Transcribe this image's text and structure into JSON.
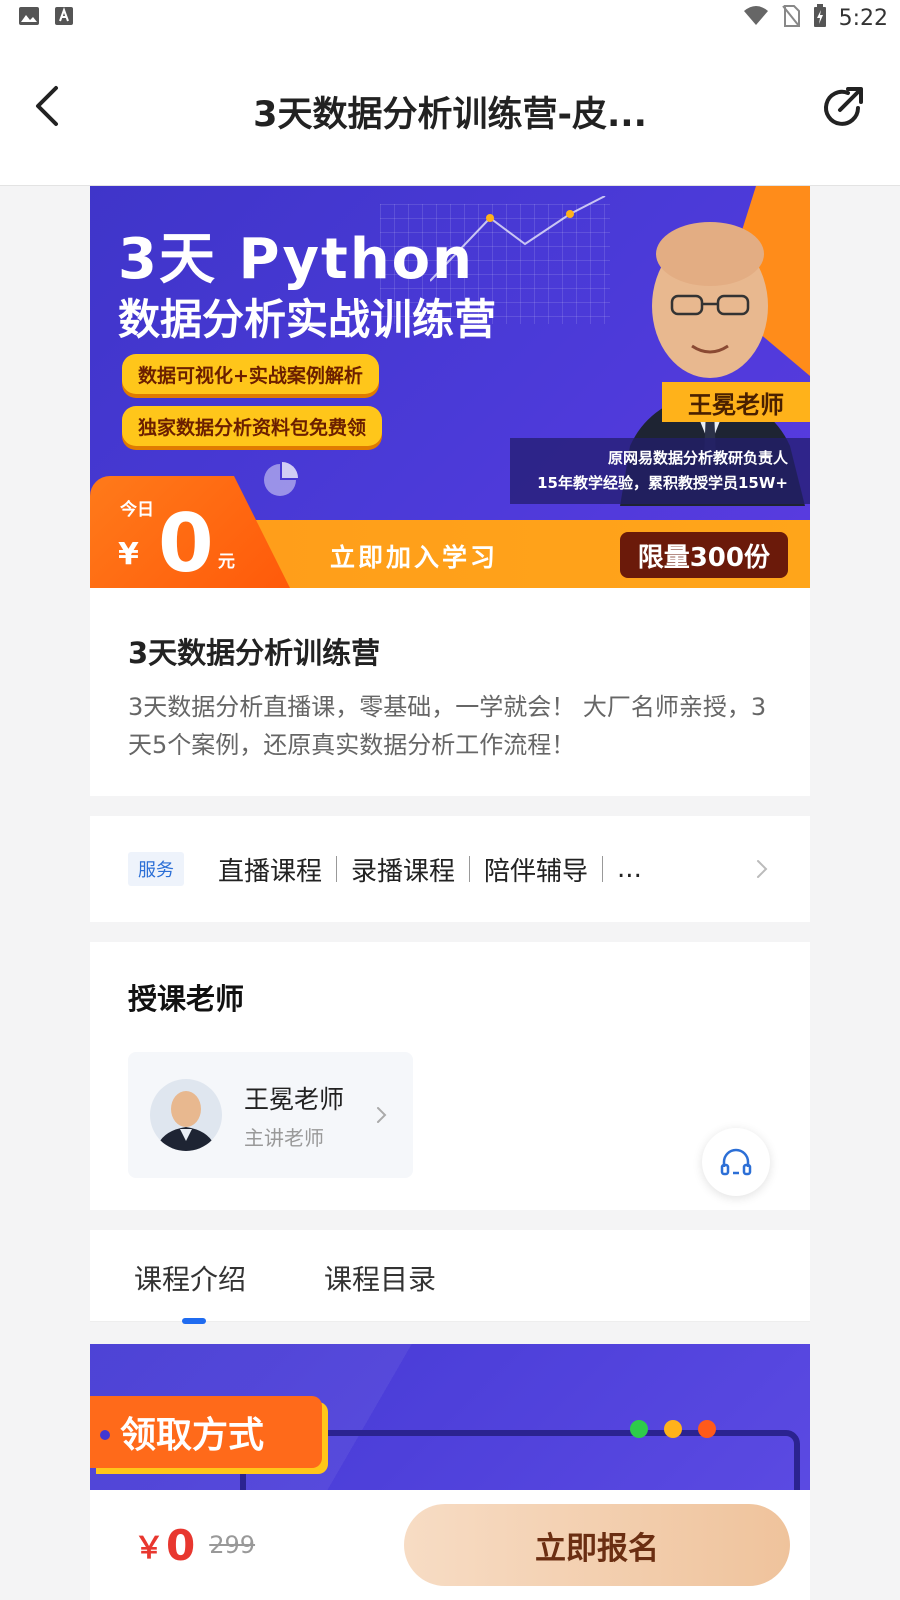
{
  "status_bar": {
    "time": "5:22",
    "left_icons": [
      "image-icon",
      "text-a-icon"
    ],
    "right_icons": [
      "wifi-icon",
      "no-sim-icon",
      "battery-charging-icon"
    ]
  },
  "nav": {
    "title": "3天数据分析训练营-皮...",
    "back_icon": "chevron-left-icon",
    "share_icon": "share-icon"
  },
  "hero": {
    "title_line1": "3天 Python",
    "title_line2": "数据分析实战训练营",
    "pill1": "数据可视化+实战案例解析",
    "pill2": "独家数据分析资料包免费领",
    "teacher_tag": "王冕老师",
    "info_line1": "原网易数据分析教研负责人",
    "info_line2": "15年教学经验，累积教授学员15W+",
    "today": "今日",
    "yen": "¥",
    "price": "0",
    "yuan": "元",
    "join_text": "立即加入学习",
    "limit_text": "限量300份"
  },
  "course": {
    "title": "3天数据分析训练营",
    "description": "3天数据分析直播课，零基础，一学就会！ 大厂名师亲授，3天5个案例，还原真实数据分析工作流程！"
  },
  "service": {
    "badge": "服务",
    "items": [
      "直播课程",
      "录播课程",
      "陪伴辅导",
      "..."
    ]
  },
  "teacher_section": {
    "heading": "授课老师",
    "name": "王冕老师",
    "role": "主讲老师"
  },
  "tabs": [
    {
      "label": "课程介绍",
      "active": true
    },
    {
      "label": "课程目录",
      "active": false
    }
  ],
  "intro_banner": {
    "label": "领取方式",
    "dot_colors": [
      "#2ecc4a",
      "#ffb21a",
      "#ff5a1a"
    ]
  },
  "bottom_bar": {
    "yen": "￥",
    "price": "0",
    "original_price": "299",
    "button_label": "立即报名"
  },
  "colors": {
    "accent_blue": "#1f6bf0",
    "price_red": "#e8372f",
    "hero_purple": "#4b3ad8",
    "hero_orange": "#ff9c1a"
  }
}
